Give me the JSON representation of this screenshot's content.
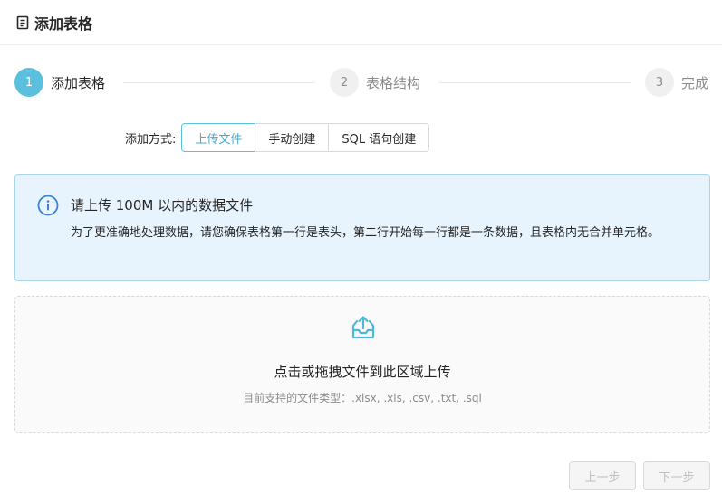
{
  "header": {
    "title": "添加表格",
    "icon": "document-icon"
  },
  "steps": [
    {
      "num": "1",
      "label": "添加表格",
      "state": "active"
    },
    {
      "num": "2",
      "label": "表格结构",
      "state": "inactive"
    },
    {
      "num": "3",
      "label": "完成",
      "state": "inactive"
    }
  ],
  "method": {
    "label": "添加方式:",
    "options": [
      "上传文件",
      "手动创建",
      "SQL 语句创建"
    ],
    "selected": "上传文件"
  },
  "info": {
    "title": "请上传 100M 以内的数据文件",
    "desc": "为了更准确地处理数据，请您确保表格第一行是表头，第二行开始每一行都是一条数据，且表格内无合并单元格。"
  },
  "upload": {
    "text": "点击或拖拽文件到此区域上传",
    "hint": "目前支持的文件类型：.xlsx, .xls, .csv, .txt, .sql"
  },
  "footer": {
    "prev": "上一步",
    "next": "下一步"
  },
  "colors": {
    "accent": "#5bc0de",
    "info_bg": "#e8f4fd",
    "info_border": "#a8d4ee",
    "info_icon": "#3b82d6",
    "upload_icon": "#4fb8d6"
  }
}
